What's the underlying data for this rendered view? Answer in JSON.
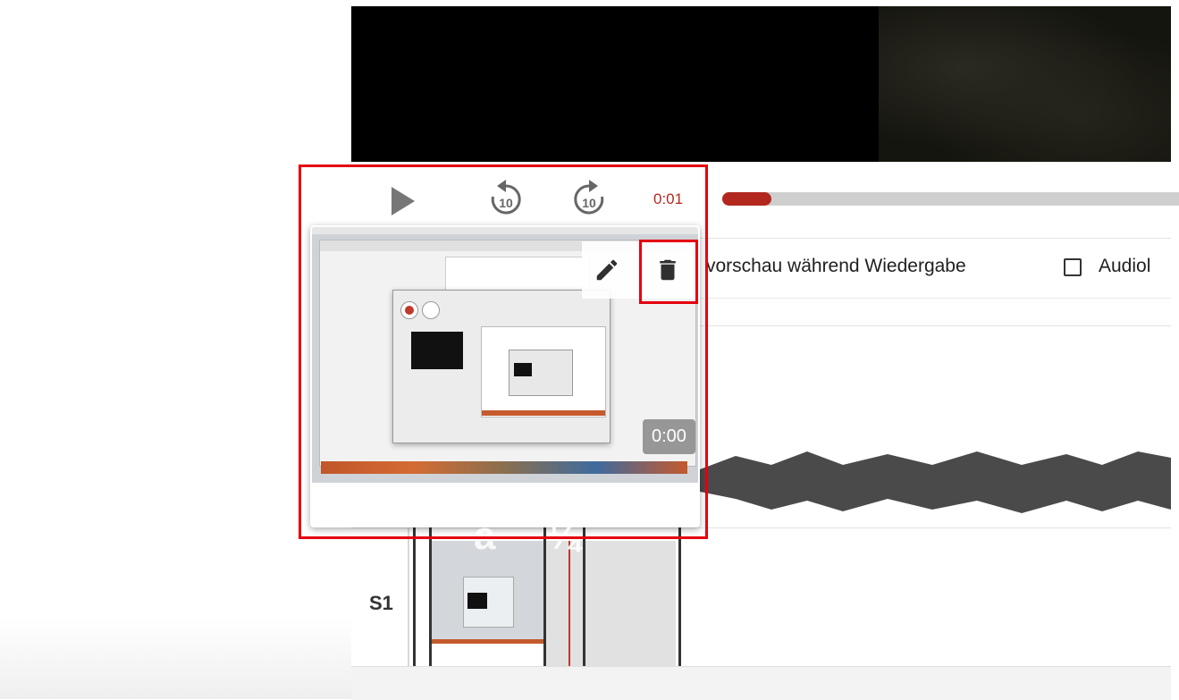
{
  "player": {
    "current_time": "0:01",
    "progress": 0.047
  },
  "options": {
    "preview_label": "vorschau während Wiedergabe",
    "audio_label": "Audiol"
  },
  "track": {
    "label": "S1"
  },
  "popup": {
    "duration": "0:00"
  },
  "colors": {
    "accent": "#b3281e",
    "highlight": "#e4000f"
  },
  "icons": {
    "play": "play-icon",
    "rewind": "rewind-10-icon",
    "forward": "forward-10-icon",
    "edit": "pencil-icon",
    "delete": "trash-icon"
  }
}
